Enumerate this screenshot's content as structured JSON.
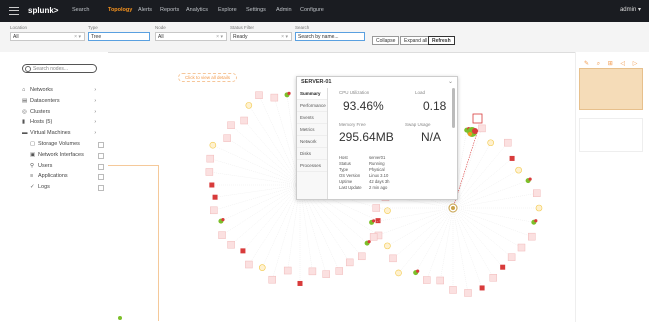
{
  "app": {
    "logo": "splunk>",
    "nav": [
      "Search",
      "Topology",
      "Alerts",
      "Reports",
      "Analytics",
      "Explore",
      "Settings",
      "Admin",
      "Configure"
    ],
    "active_nav": 1,
    "user": "admin ▾"
  },
  "filters": [
    {
      "label": "Location",
      "value": "All"
    },
    {
      "label": "Type",
      "value": "Tree"
    },
    {
      "label": "Node",
      "value": "All"
    },
    {
      "label": "Status Filter",
      "value": "Ready"
    },
    {
      "label": "Search",
      "value": "Search by name..."
    }
  ],
  "buttons": {
    "collapse": "Collapse",
    "expand": "Expand all",
    "refresh": "Refresh"
  },
  "sidebar": {
    "search_placeholder": "Search nodes...",
    "items": [
      {
        "label": "Networks",
        "icon": "⌂",
        "type": "caret"
      },
      {
        "label": "Datacenters",
        "icon": "▤",
        "type": "caret"
      },
      {
        "label": "Clusters",
        "icon": "◎",
        "type": "caret"
      },
      {
        "label": "Hosts (5)",
        "icon": "▮",
        "type": "caret"
      },
      {
        "label": "Virtual Machines",
        "icon": "▬",
        "type": "caret"
      },
      {
        "label": "Storage Volumes",
        "icon": "▢",
        "type": "check"
      },
      {
        "label": "Network Interfaces",
        "icon": "▣",
        "type": "check"
      },
      {
        "label": "Users",
        "icon": "⚲",
        "type": "check"
      },
      {
        "label": "Applications",
        "icon": "≡",
        "type": "check"
      },
      {
        "label": "Logs",
        "icon": "✓",
        "type": "check"
      }
    ]
  },
  "canvas": {
    "note": "Click to view all details"
  },
  "popup": {
    "title": "SERVER-01",
    "tabs": [
      "Summary",
      "Performance",
      "Events",
      "Metrics",
      "Network",
      "Disks",
      "Processes"
    ],
    "cpu_label": "CPU Utilization",
    "cpu_value": "93.46%",
    "load_label": "Load",
    "load_value": "0.18",
    "mem_label": "Memory Free",
    "mem_value": "295.64MB",
    "swap_label": "Swap Usage",
    "swap_value": "N/A",
    "details": [
      {
        "k": "Host",
        "v": "server01"
      },
      {
        "k": "Status",
        "v": "Running"
      },
      {
        "k": "Type",
        "v": "Physical"
      },
      {
        "k": "OS Version",
        "v": "Linux 3.10"
      },
      {
        "k": "Uptime",
        "v": "42 days 3h"
      },
      {
        "k": "Last Update",
        "v": "2 min ago"
      }
    ]
  },
  "colors": {
    "accent": "#f7931e",
    "healthy": "#7cbf2a",
    "critical": "#d83b3b",
    "warning": "#f2c94c",
    "topbar": "#1a1c21"
  }
}
